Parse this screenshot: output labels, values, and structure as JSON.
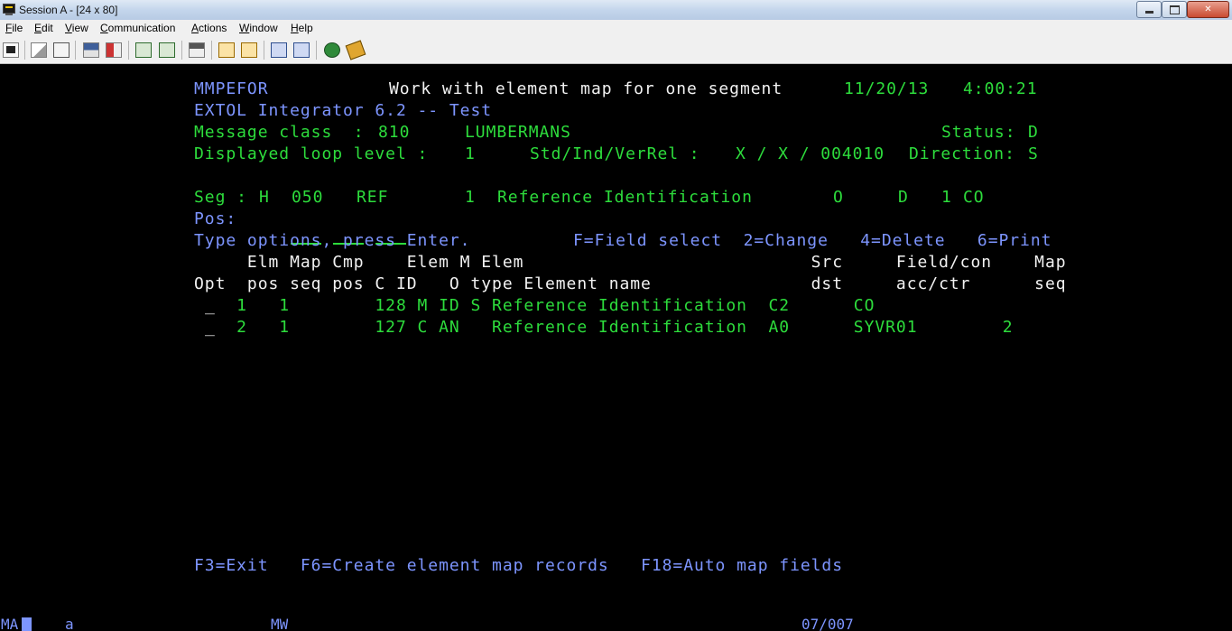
{
  "window": {
    "title": "Session A - [24 x 80]",
    "close_glyph": "✕"
  },
  "menu": [
    "File",
    "Edit",
    "View",
    "Communication",
    "Actions",
    "Window",
    "Help"
  ],
  "toolbar_icons": [
    "print-screen-icon",
    "copy-icon",
    "paste-icon",
    "send-icon",
    "receive-icon",
    "display-icon",
    "keypad-icon",
    "record-macro-icon",
    "play-macro-icon",
    "macro-stop-icon",
    "macro-edit-icon",
    "globe-icon",
    "customize-icon"
  ],
  "terminal": {
    "program": "MMPEFOR",
    "screen_title": "Work with element map for one segment",
    "date": "11/20/13",
    "time": "4:00:21",
    "product": "EXTOL Integrator 6.2 -- Test",
    "message_class_label": "Message class  :",
    "message_class": "810",
    "partner": "LUMBERMANS",
    "status_label": "Status:",
    "status": "D",
    "loop_level_label": "Displayed loop level :",
    "loop_level": "1",
    "std_label": "Std/Ind/VerRel :",
    "std_value": "X / X / 004010",
    "direction_label": "Direction:",
    "direction": "S",
    "seg_label": "Seg :",
    "seg_area": "H",
    "seg_pos": "050",
    "seg_id": "REF",
    "seg_loop": "1",
    "seg_name": "Reference Identification",
    "seg_req": "O",
    "seg_flag": "D",
    "seg_max": "1",
    "seg_code": "CO",
    "pos_label": "Pos:",
    "instructions": "Type options, press Enter.",
    "options": "F=Field select  2=Change   4=Delete   6=Print",
    "header1": "     Elm Map Cmp    Elem M Elem                           Src     Field/con    Map",
    "header2": "Opt  pos seq pos C ID   O type Element name               dst     acc/ctr      seq",
    "rows": [
      {
        "opt": "_",
        "line": "    1   1        128 M ID S Reference Identification  C2      CO"
      },
      {
        "opt": "_",
        "line": "    2   1        127 C AN   Reference Identification  A0      SYVR01        2"
      }
    ],
    "fkeys": "F3=Exit   F6=Create element map records   F18=Auto map fields"
  },
  "oia": {
    "mode": "MA",
    "indicator": "a",
    "session_type": "MW",
    "cursor_pos": "07/007"
  }
}
